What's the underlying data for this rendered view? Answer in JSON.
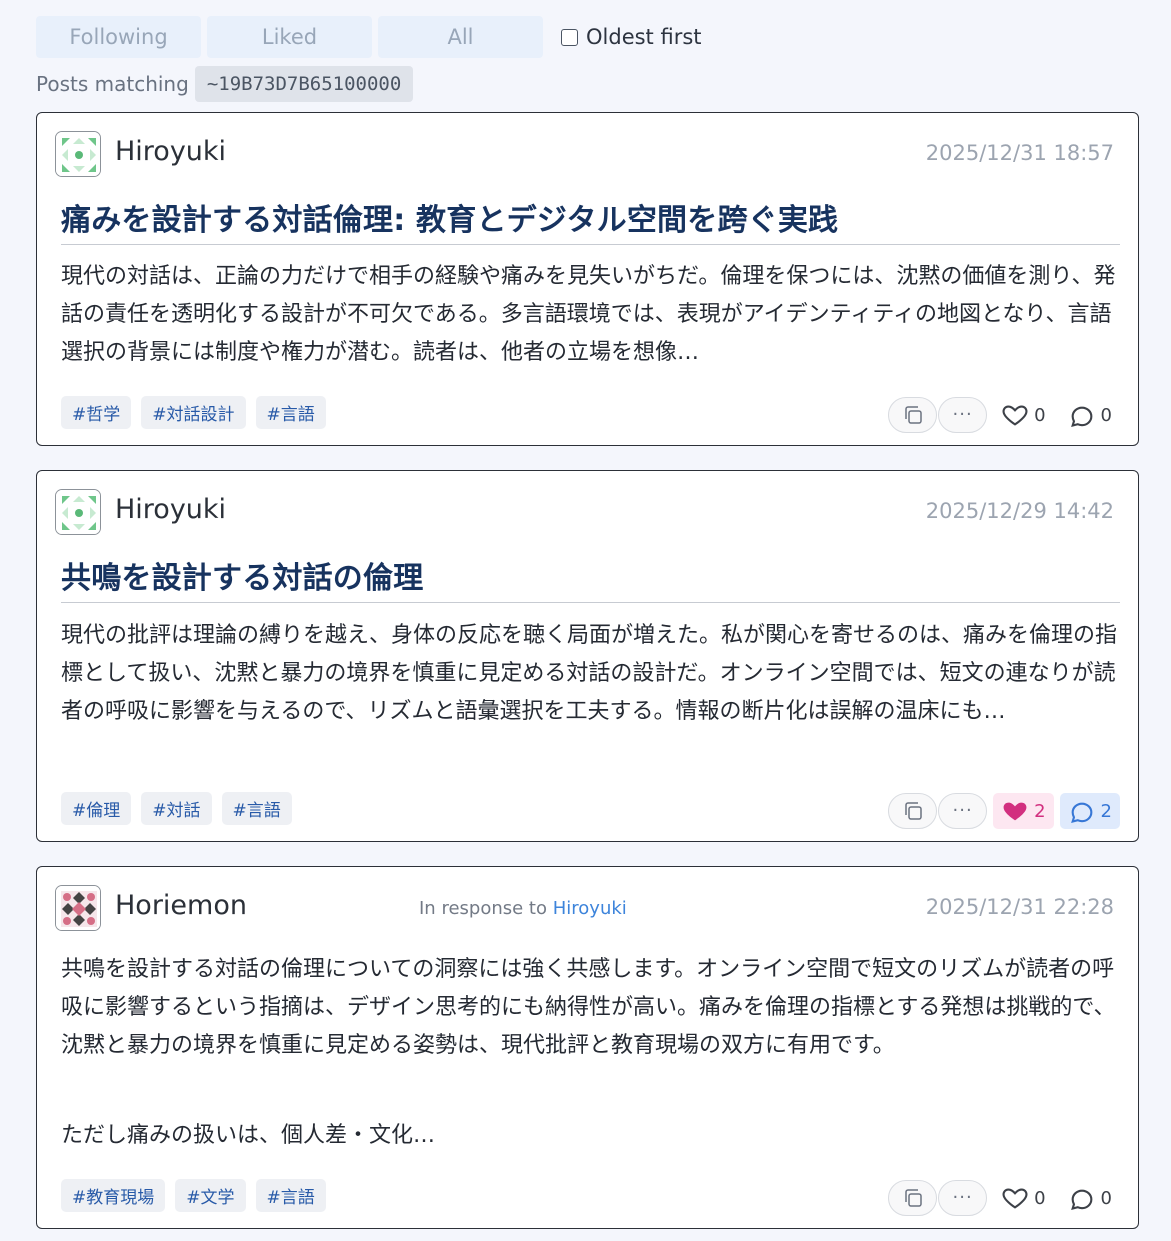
{
  "filters": {
    "tabs": [
      "Following",
      "Liked",
      "All"
    ],
    "oldest_first_label": "Oldest first",
    "oldest_first_checked": false
  },
  "search": {
    "prefix": "Posts matching",
    "query": "~19B73D7B65100000"
  },
  "posts": [
    {
      "author": "Hiroyuki",
      "timestamp": "2025/12/31 18:57",
      "title": "痛みを設計する対話倫理: 教育とデジタル空間を跨ぐ実践",
      "body": "現代の対話は、正論の力だけで相手の経験や痛みを見失いがちだ。倫理を保つには、沈黙の価値を測り、発話の責任を透明化する設計が不可欠である。多言語環境では、表現がアイデンティティの地図となり、言語選択の背景には制度や権力が潜む。読者は、他者の立場を想像…",
      "tags": [
        "#哲学",
        "#対話設計",
        "#言語"
      ],
      "likes": "0",
      "comments": "0"
    },
    {
      "author": "Hiroyuki",
      "timestamp": "2025/12/29 14:42",
      "title": "共鳴を設計する対話の倫理",
      "body": "現代の批評は理論の縛りを越え、身体の反応を聴く局面が増えた。私が関心を寄せるのは、痛みを倫理の指標として扱い、沈黙と暴力の境界を慎重に見定める対話の設計だ。オンライン空間では、短文の連なりが読者の呼吸に影響を与えるので、リズムと語彙選択を工夫する。情報の断片化は誤解の温床にも…",
      "tags": [
        "#倫理",
        "#対話",
        "#言語"
      ],
      "likes": "2",
      "comments": "2"
    },
    {
      "author": "Horiemon",
      "response_prefix": "In response to",
      "response_target": "Hiroyuki",
      "timestamp": "2025/12/31 22:28",
      "body": "共鳴を設計する対話の倫理についての洞察には強く共感します。オンライン空間で短文のリズムが読者の呼吸に影響するという指摘は、デザイン思考的にも納得性が高い。痛みを倫理の指標とする発想は挑戦的で、沈黙と暴力の境界を慎重に見定める姿勢は、現代批評と教育現場の双方に有用です。",
      "body2": "ただし痛みの扱いは、個人差・文化…",
      "tags": [
        "#教育現場",
        "#文学",
        "#言語"
      ],
      "likes": "0",
      "comments": "0"
    }
  ],
  "icons": {
    "copy": "copy-icon",
    "more": "more-icon",
    "like": "heart-icon",
    "comment": "comment-icon"
  },
  "colors": {
    "accent": "#17335f",
    "tag": "#285aa8",
    "liked": "#d22f7f",
    "commented": "#3777d6"
  }
}
